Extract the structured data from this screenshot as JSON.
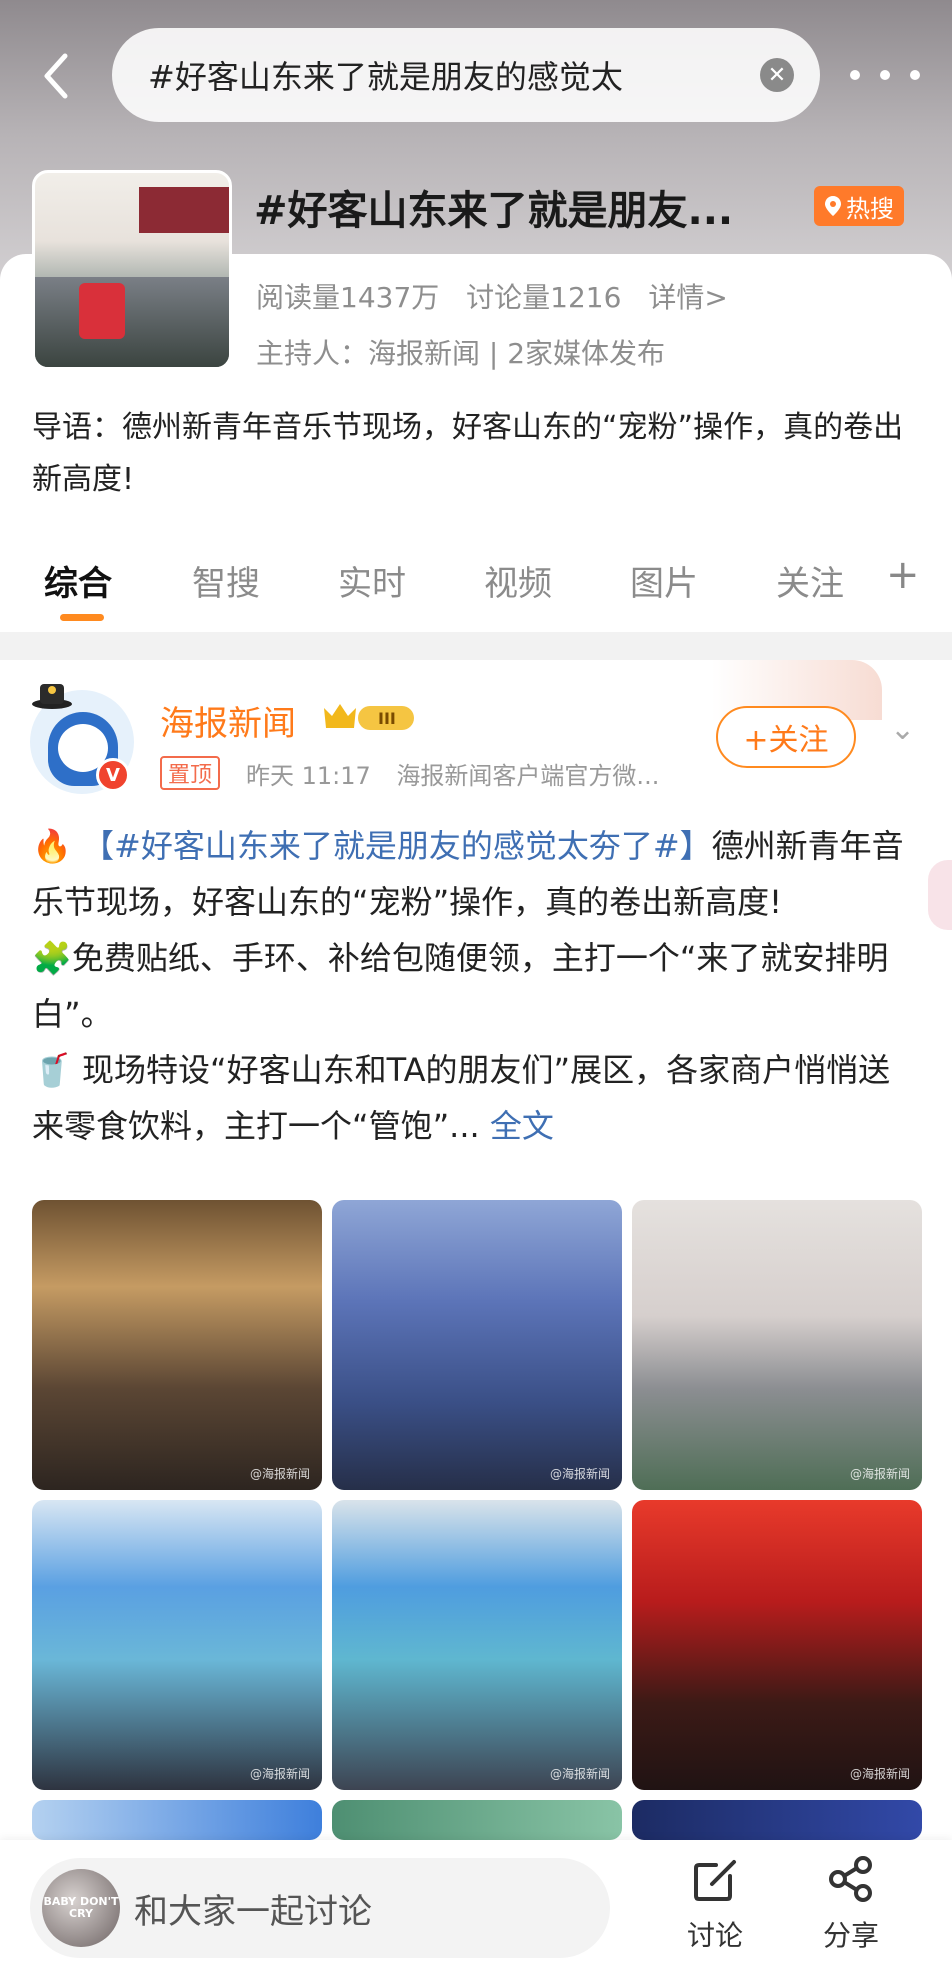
{
  "search": {
    "query": "#好客山东来了就是朋友的感觉太"
  },
  "topic": {
    "title": "#好客山东来了就是朋友...",
    "hot_label": "热搜",
    "reads": "阅读量1437万",
    "discussions": "讨论量1216",
    "details": "详情>",
    "host": "主持人：海报新闻 | 2家媒体发布",
    "lead": "导语：德州新青年音乐节现场，好客山东的“宠粉”操作，真的卷出新高度!"
  },
  "tabs": [
    "综合",
    "智搜",
    "实时",
    "视频",
    "图片",
    "关注"
  ],
  "post": {
    "author": "海报新闻",
    "level": "III",
    "pinned": "置顶",
    "time": "昨天 11:17",
    "source": "海报新闻客户端官方微...",
    "follow": "+关注",
    "verified": "V",
    "hashtag": "【#好客山东来了就是朋友的感觉太夯了#】",
    "line1_rest": "德州新青年音乐节现场，好客山东的“宠粉”操作，真的卷出新高度!",
    "line2": "免费贴纸、手环、补给包随便领，主打一个“来了就安排明白”。",
    "line3": "现场特设“好客山东和TA的朋友们”展区，各家商户悄悄送来零食饮料，主打一个“管饱”...",
    "full_text": "全文",
    "image_watermark": "@海报新闻"
  },
  "bottom": {
    "comment_placeholder": "和大家一起讨论",
    "me_avatar_text": "BABY DON'T CRY",
    "discuss": "讨论",
    "share": "分享"
  }
}
